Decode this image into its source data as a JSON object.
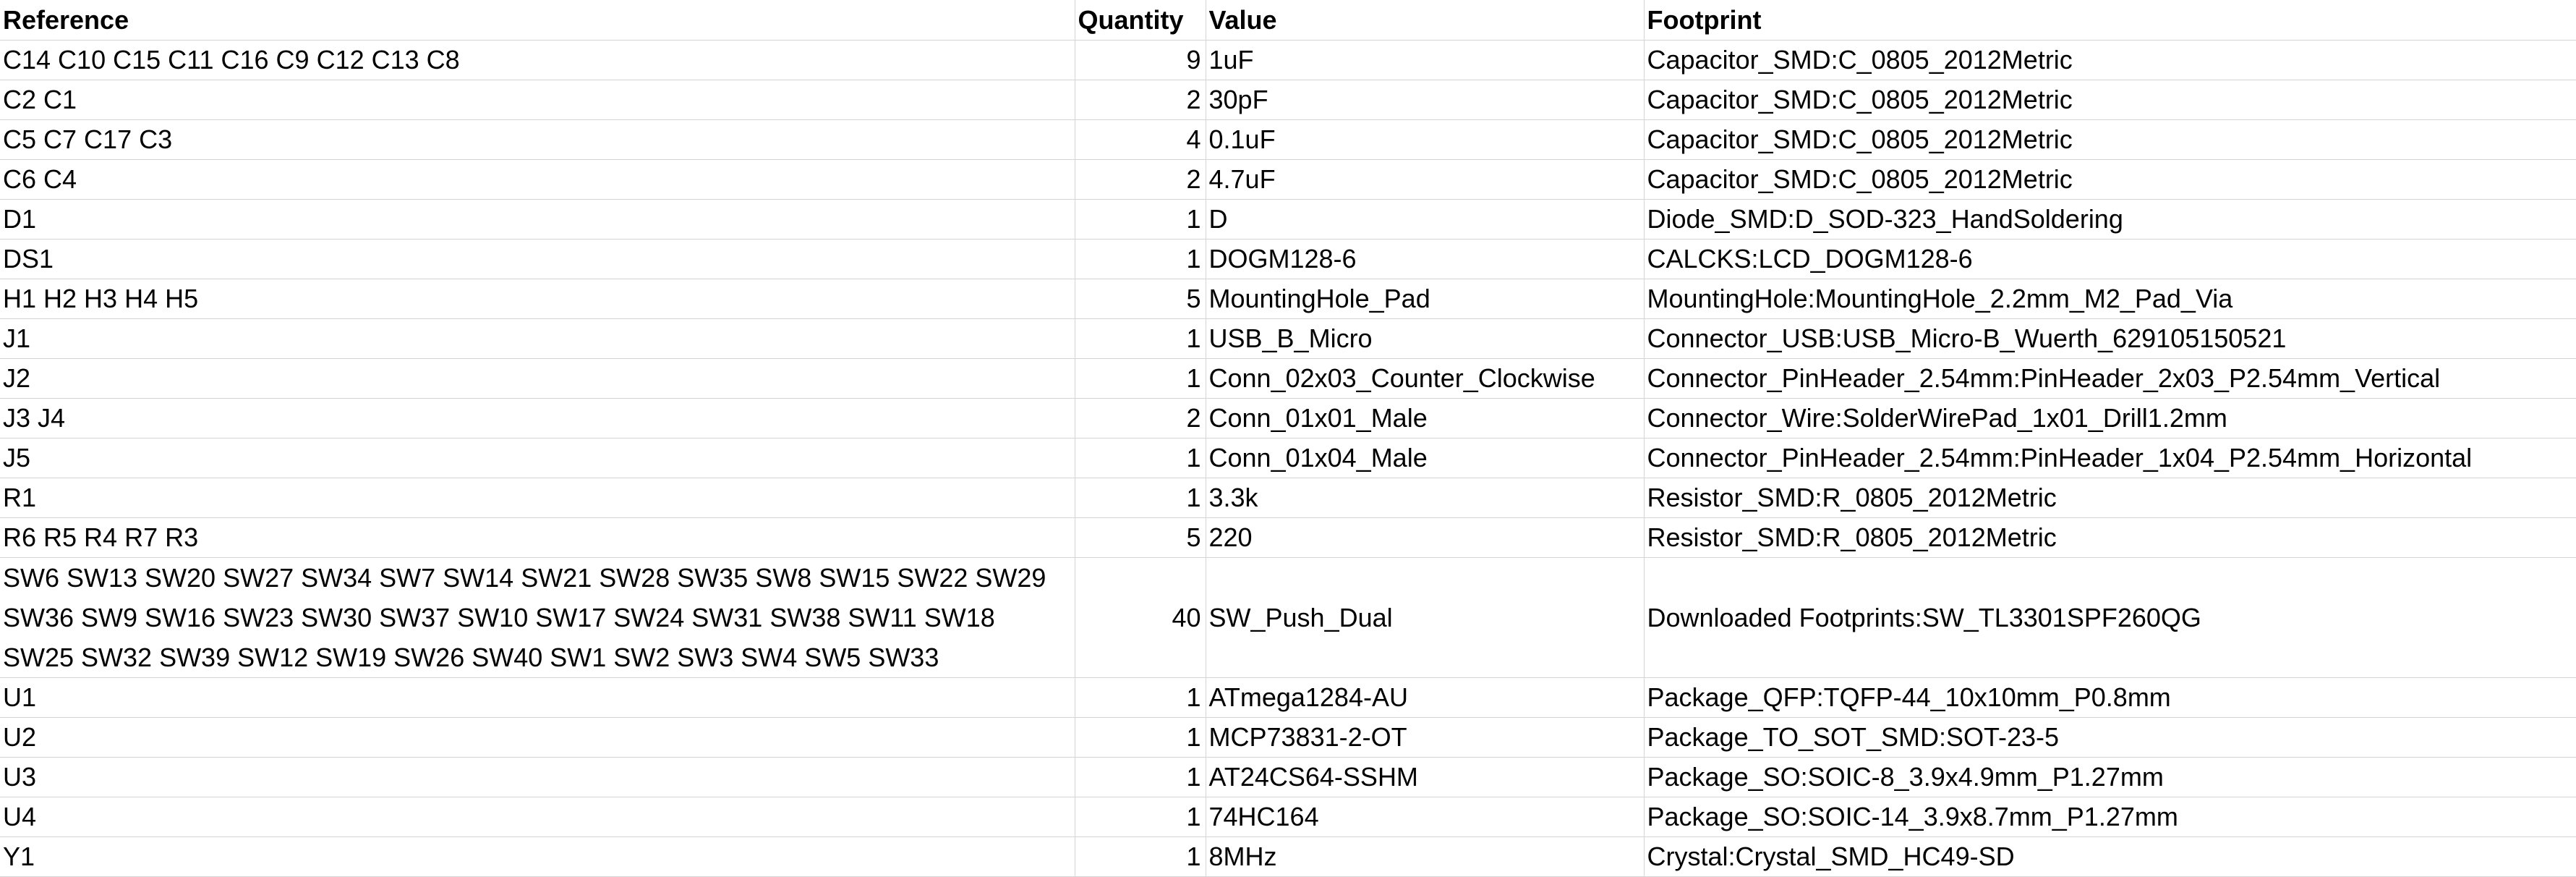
{
  "headers": {
    "reference": "Reference",
    "quantity": "Quantity",
    "value": "Value",
    "footprint": "Footprint"
  },
  "rows": [
    {
      "reference": "C14 C10 C15 C11 C16 C9 C12 C13 C8",
      "quantity": "9",
      "value": "1uF",
      "footprint": "Capacitor_SMD:C_0805_2012Metric"
    },
    {
      "reference": "C2 C1",
      "quantity": "2",
      "value": "30pF",
      "footprint": "Capacitor_SMD:C_0805_2012Metric"
    },
    {
      "reference": "C5 C7 C17 C3",
      "quantity": "4",
      "value": "0.1uF",
      "footprint": "Capacitor_SMD:C_0805_2012Metric"
    },
    {
      "reference": "C6 C4",
      "quantity": "2",
      "value": "4.7uF",
      "footprint": "Capacitor_SMD:C_0805_2012Metric"
    },
    {
      "reference": "D1",
      "quantity": "1",
      "value": "D",
      "footprint": "Diode_SMD:D_SOD-323_HandSoldering"
    },
    {
      "reference": "DS1",
      "quantity": "1",
      "value": "DOGM128-6",
      "footprint": "CALCKS:LCD_DOGM128-6"
    },
    {
      "reference": "H1 H2 H3 H4 H5",
      "quantity": "5",
      "value": "MountingHole_Pad",
      "footprint": "MountingHole:MountingHole_2.2mm_M2_Pad_Via"
    },
    {
      "reference": "J1",
      "quantity": "1",
      "value": "USB_B_Micro",
      "footprint": "Connector_USB:USB_Micro-B_Wuerth_629105150521"
    },
    {
      "reference": "J2",
      "quantity": "1",
      "value": "Conn_02x03_Counter_Clockwise",
      "footprint": "Connector_PinHeader_2.54mm:PinHeader_2x03_P2.54mm_Vertical"
    },
    {
      "reference": "J3 J4",
      "quantity": "2",
      "value": "Conn_01x01_Male",
      "footprint": "Connector_Wire:SolderWirePad_1x01_Drill1.2mm"
    },
    {
      "reference": "J5",
      "quantity": "1",
      "value": "Conn_01x04_Male",
      "footprint": "Connector_PinHeader_2.54mm:PinHeader_1x04_P2.54mm_Horizontal"
    },
    {
      "reference": "R1",
      "quantity": "1",
      "value": "3.3k",
      "footprint": "Resistor_SMD:R_0805_2012Metric"
    },
    {
      "reference": "R6 R5 R4 R7 R3",
      "quantity": "5",
      "value": "220",
      "footprint": "Resistor_SMD:R_0805_2012Metric"
    },
    {
      "reference_lines": [
        "SW6 SW13 SW20 SW27 SW34 SW7 SW14 SW21 SW28 SW35 SW8 SW15 SW22 SW29",
        "SW36 SW9 SW16 SW23 SW30 SW37 SW10 SW17 SW24 SW31 SW38 SW11 SW18",
        "SW25 SW32 SW39 SW12 SW19 SW26 SW40 SW1 SW2 SW3 SW4 SW5 SW33"
      ],
      "quantity": "40",
      "value": "SW_Push_Dual",
      "footprint": "Downloaded Footprints:SW_TL3301SPF260QG"
    },
    {
      "reference": "U1",
      "quantity": "1",
      "value": "ATmega1284-AU",
      "footprint": "Package_QFP:TQFP-44_10x10mm_P0.8mm"
    },
    {
      "reference": "U2",
      "quantity": "1",
      "value": "MCP73831-2-OT",
      "footprint": "Package_TO_SOT_SMD:SOT-23-5"
    },
    {
      "reference": "U3",
      "quantity": "1",
      "value": "AT24CS64-SSHM",
      "footprint": "Package_SO:SOIC-8_3.9x4.9mm_P1.27mm"
    },
    {
      "reference": "U4",
      "quantity": "1",
      "value": "74HC164",
      "footprint": "Package_SO:SOIC-14_3.9x8.7mm_P1.27mm"
    },
    {
      "reference": "Y1",
      "quantity": "1",
      "value": "8MHz",
      "footprint": "Crystal:Crystal_SMD_HC49-SD"
    }
  ]
}
